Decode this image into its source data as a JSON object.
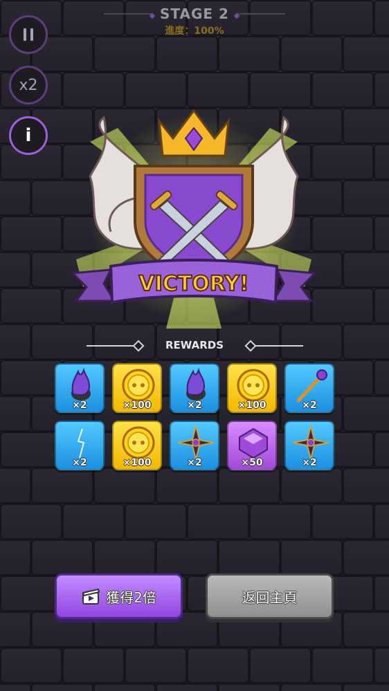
{
  "hud": {
    "stage": "STAGE 2",
    "progress": "進度：100%",
    "pause_icon": "pause-icon",
    "speed_label": "x2",
    "info_label": "i"
  },
  "victory": {
    "banner_text": "VICTORY!",
    "emblem_icon": "winged-shield-crossed-swords-crown"
  },
  "rewards": {
    "title": "REWARDS",
    "items": [
      {
        "icon": "purple-flame-icon",
        "bg": "blue",
        "qty": "×2"
      },
      {
        "icon": "gold-coin-icon",
        "bg": "yellow",
        "qty": "×100"
      },
      {
        "icon": "purple-flame-icon",
        "bg": "blue",
        "qty": "×2"
      },
      {
        "icon": "gold-coin-icon",
        "bg": "yellow",
        "qty": "×100"
      },
      {
        "icon": "magic-staff-icon",
        "bg": "blue",
        "qty": "×2"
      },
      {
        "icon": "lightning-icon",
        "bg": "blue",
        "qty": "×2"
      },
      {
        "icon": "gold-coin-icon",
        "bg": "yellow",
        "qty": "×100"
      },
      {
        "icon": "shuriken-cross-icon",
        "bg": "blue",
        "qty": "×2"
      },
      {
        "icon": "purple-gem-icon",
        "bg": "purple",
        "qty": "×50"
      },
      {
        "icon": "shuriken-cross-icon",
        "bg": "blue",
        "qty": "×2"
      }
    ]
  },
  "buttons": {
    "double_label": "獲得2倍",
    "double_icon": "video-clapper-icon",
    "home_label": "返回主頁"
  },
  "colors": {
    "accent": "#9a62e0",
    "card_blue": "#1c8fe0",
    "card_yellow": "#f3b800",
    "card_purple": "#a04ad9",
    "banner_text": "#ffcc33"
  }
}
